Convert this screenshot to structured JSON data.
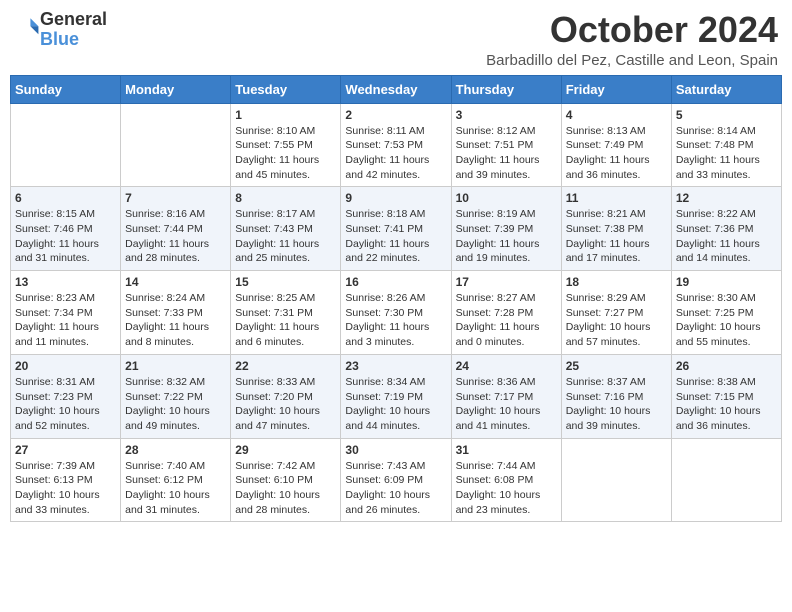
{
  "header": {
    "logo_general": "General",
    "logo_blue": "Blue",
    "month_title": "October 2024",
    "location": "Barbadillo del Pez, Castille and Leon, Spain"
  },
  "weekdays": [
    "Sunday",
    "Monday",
    "Tuesday",
    "Wednesday",
    "Thursday",
    "Friday",
    "Saturday"
  ],
  "weeks": [
    [
      {
        "day": "",
        "info": ""
      },
      {
        "day": "",
        "info": ""
      },
      {
        "day": "1",
        "info": "Sunrise: 8:10 AM\nSunset: 7:55 PM\nDaylight: 11 hours and 45 minutes."
      },
      {
        "day": "2",
        "info": "Sunrise: 8:11 AM\nSunset: 7:53 PM\nDaylight: 11 hours and 42 minutes."
      },
      {
        "day": "3",
        "info": "Sunrise: 8:12 AM\nSunset: 7:51 PM\nDaylight: 11 hours and 39 minutes."
      },
      {
        "day": "4",
        "info": "Sunrise: 8:13 AM\nSunset: 7:49 PM\nDaylight: 11 hours and 36 minutes."
      },
      {
        "day": "5",
        "info": "Sunrise: 8:14 AM\nSunset: 7:48 PM\nDaylight: 11 hours and 33 minutes."
      }
    ],
    [
      {
        "day": "6",
        "info": "Sunrise: 8:15 AM\nSunset: 7:46 PM\nDaylight: 11 hours and 31 minutes."
      },
      {
        "day": "7",
        "info": "Sunrise: 8:16 AM\nSunset: 7:44 PM\nDaylight: 11 hours and 28 minutes."
      },
      {
        "day": "8",
        "info": "Sunrise: 8:17 AM\nSunset: 7:43 PM\nDaylight: 11 hours and 25 minutes."
      },
      {
        "day": "9",
        "info": "Sunrise: 8:18 AM\nSunset: 7:41 PM\nDaylight: 11 hours and 22 minutes."
      },
      {
        "day": "10",
        "info": "Sunrise: 8:19 AM\nSunset: 7:39 PM\nDaylight: 11 hours and 19 minutes."
      },
      {
        "day": "11",
        "info": "Sunrise: 8:21 AM\nSunset: 7:38 PM\nDaylight: 11 hours and 17 minutes."
      },
      {
        "day": "12",
        "info": "Sunrise: 8:22 AM\nSunset: 7:36 PM\nDaylight: 11 hours and 14 minutes."
      }
    ],
    [
      {
        "day": "13",
        "info": "Sunrise: 8:23 AM\nSunset: 7:34 PM\nDaylight: 11 hours and 11 minutes."
      },
      {
        "day": "14",
        "info": "Sunrise: 8:24 AM\nSunset: 7:33 PM\nDaylight: 11 hours and 8 minutes."
      },
      {
        "day": "15",
        "info": "Sunrise: 8:25 AM\nSunset: 7:31 PM\nDaylight: 11 hours and 6 minutes."
      },
      {
        "day": "16",
        "info": "Sunrise: 8:26 AM\nSunset: 7:30 PM\nDaylight: 11 hours and 3 minutes."
      },
      {
        "day": "17",
        "info": "Sunrise: 8:27 AM\nSunset: 7:28 PM\nDaylight: 11 hours and 0 minutes."
      },
      {
        "day": "18",
        "info": "Sunrise: 8:29 AM\nSunset: 7:27 PM\nDaylight: 10 hours and 57 minutes."
      },
      {
        "day": "19",
        "info": "Sunrise: 8:30 AM\nSunset: 7:25 PM\nDaylight: 10 hours and 55 minutes."
      }
    ],
    [
      {
        "day": "20",
        "info": "Sunrise: 8:31 AM\nSunset: 7:23 PM\nDaylight: 10 hours and 52 minutes."
      },
      {
        "day": "21",
        "info": "Sunrise: 8:32 AM\nSunset: 7:22 PM\nDaylight: 10 hours and 49 minutes."
      },
      {
        "day": "22",
        "info": "Sunrise: 8:33 AM\nSunset: 7:20 PM\nDaylight: 10 hours and 47 minutes."
      },
      {
        "day": "23",
        "info": "Sunrise: 8:34 AM\nSunset: 7:19 PM\nDaylight: 10 hours and 44 minutes."
      },
      {
        "day": "24",
        "info": "Sunrise: 8:36 AM\nSunset: 7:17 PM\nDaylight: 10 hours and 41 minutes."
      },
      {
        "day": "25",
        "info": "Sunrise: 8:37 AM\nSunset: 7:16 PM\nDaylight: 10 hours and 39 minutes."
      },
      {
        "day": "26",
        "info": "Sunrise: 8:38 AM\nSunset: 7:15 PM\nDaylight: 10 hours and 36 minutes."
      }
    ],
    [
      {
        "day": "27",
        "info": "Sunrise: 7:39 AM\nSunset: 6:13 PM\nDaylight: 10 hours and 33 minutes."
      },
      {
        "day": "28",
        "info": "Sunrise: 7:40 AM\nSunset: 6:12 PM\nDaylight: 10 hours and 31 minutes."
      },
      {
        "day": "29",
        "info": "Sunrise: 7:42 AM\nSunset: 6:10 PM\nDaylight: 10 hours and 28 minutes."
      },
      {
        "day": "30",
        "info": "Sunrise: 7:43 AM\nSunset: 6:09 PM\nDaylight: 10 hours and 26 minutes."
      },
      {
        "day": "31",
        "info": "Sunrise: 7:44 AM\nSunset: 6:08 PM\nDaylight: 10 hours and 23 minutes."
      },
      {
        "day": "",
        "info": ""
      },
      {
        "day": "",
        "info": ""
      }
    ]
  ]
}
